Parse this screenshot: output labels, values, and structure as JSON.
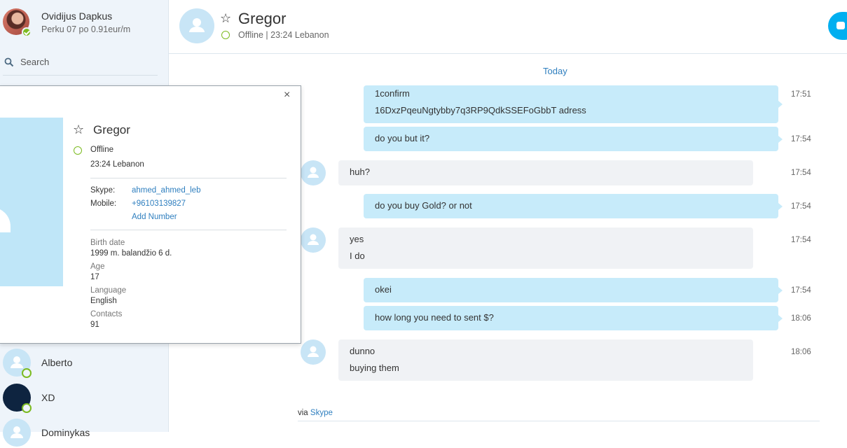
{
  "me": {
    "name": "Ovidijus Dapkus",
    "mood": "Perku 07 po 0.91eur/m"
  },
  "search": {
    "label": "Search"
  },
  "contacts": [
    {
      "name": "Alberto"
    },
    {
      "name": "XD"
    },
    {
      "name": "Dominykas"
    }
  ],
  "header": {
    "name": "Gregor",
    "status": "Offline",
    "separator": "|",
    "local_time": "23:24 Lebanon"
  },
  "chat": {
    "day_divider": "Today",
    "messages": [
      {
        "dir": "out",
        "lines": [
          "1confirm",
          "16DxzPqeuNgtybby7q3RP9QdkSSEFoGbbT adress"
        ],
        "time": "17:51"
      },
      {
        "dir": "out",
        "lines": [
          "do you but it?"
        ],
        "time": "17:54"
      },
      {
        "dir": "in",
        "lines": [
          "huh?"
        ],
        "time": "17:54"
      },
      {
        "dir": "out",
        "lines": [
          "do you buy Gold? or not"
        ],
        "time": "17:54"
      },
      {
        "dir": "in",
        "lines": [
          "yes",
          "I do"
        ],
        "time": "17:54"
      },
      {
        "dir": "out",
        "lines": [
          "okei"
        ],
        "time": "17:54"
      },
      {
        "dir": "out",
        "lines": [
          "how long you need to sent $?"
        ],
        "time": "18:06"
      },
      {
        "dir": "in",
        "lines": [
          "dunno",
          "buying them"
        ],
        "time": "18:06"
      }
    ],
    "via_prefix": "via",
    "via_link": "Skype"
  },
  "profile": {
    "name": "Gregor",
    "status": "Offline",
    "local_time": "23:24 Lebanon",
    "skype_label": "Skype:",
    "skype_value": "ahmed_ahmed_leb",
    "mobile_label": "Mobile:",
    "mobile_value": "+96103139827",
    "add_number": "Add Number",
    "birth_label": "Birth date",
    "birth_value": "1999 m. balandžio 6 d.",
    "age_label": "Age",
    "age_value": "17",
    "language_label": "Language",
    "language_value": "English",
    "contacts_label": "Contacts",
    "contacts_value": "91",
    "close_icon": "×",
    "star_icon": "☆"
  },
  "colors": {
    "accent": "#00aff0",
    "link": "#2f7fbf",
    "online": "#7cbb21",
    "bubble_out": "#c7ebfa",
    "bubble_in": "#f0f2f5"
  }
}
